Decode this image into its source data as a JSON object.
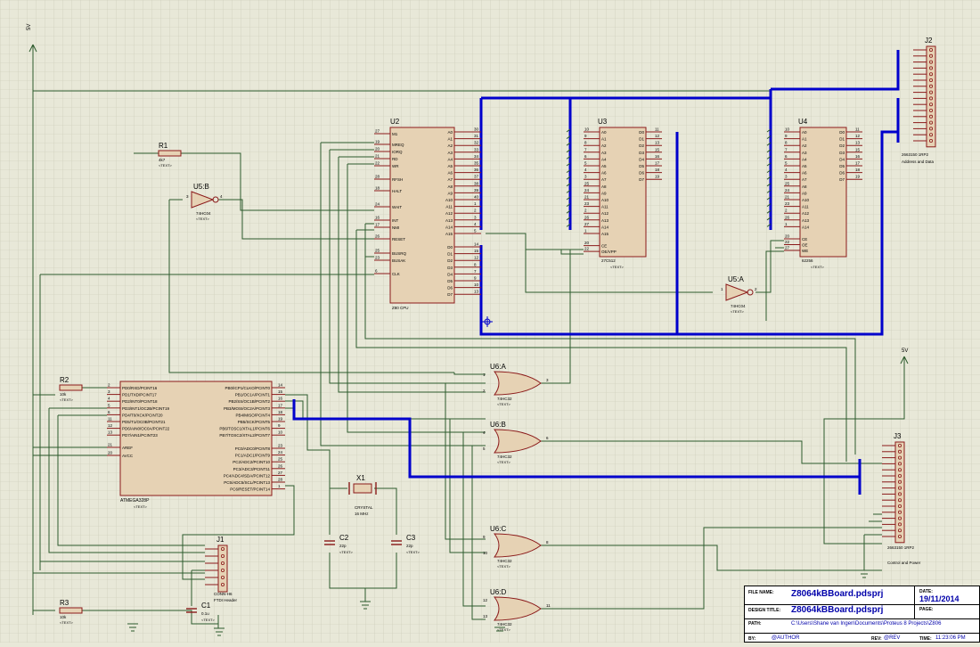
{
  "rail": {
    "left_top": "5V",
    "right": "5V"
  },
  "parts": {
    "R1": {
      "ref": "R1",
      "value": "4k7",
      "text": "<TEXT>"
    },
    "R2": {
      "ref": "R2",
      "value": "10k",
      "text": "<TEXT>"
    },
    "R3": {
      "ref": "R3",
      "value": "10k",
      "text": "<TEXT>"
    },
    "U5B": {
      "ref": "U5:B",
      "value": "74HC04",
      "text": "<TEXT>",
      "pin_in": "3",
      "pin_out": "4"
    },
    "U5A": {
      "ref": "U5:A",
      "value": "74HC04",
      "text": "<TEXT>",
      "pin_in": "1",
      "pin_out": "2"
    },
    "U2": {
      "ref": "U2",
      "value": "Z80 CPU",
      "left_pins": [
        {
          "num": "27",
          "name": "M1"
        },
        {
          "num": "19",
          "name": "MREQ"
        },
        {
          "num": "20",
          "name": "IORQ"
        },
        {
          "num": "21",
          "name": "RD"
        },
        {
          "num": "22",
          "name": "WR"
        },
        {
          "num": "28",
          "name": "RFSH"
        },
        {
          "num": "18",
          "name": "HALT"
        },
        {
          "num": "24",
          "name": "WAIT"
        },
        {
          "num": "16",
          "name": "INT"
        },
        {
          "num": "17",
          "name": "NMI"
        },
        {
          "num": "26",
          "name": "RESET"
        },
        {
          "num": "25",
          "name": "BUSRQ"
        },
        {
          "num": "23",
          "name": "BUSAK"
        },
        {
          "num": "6",
          "name": "CLK"
        }
      ],
      "addr_pins": [
        {
          "num": "30",
          "name": "A0"
        },
        {
          "num": "31",
          "name": "A1"
        },
        {
          "num": "32",
          "name": "A2"
        },
        {
          "num": "33",
          "name": "A3"
        },
        {
          "num": "34",
          "name": "A4"
        },
        {
          "num": "35",
          "name": "A5"
        },
        {
          "num": "36",
          "name": "A6"
        },
        {
          "num": "37",
          "name": "A7"
        },
        {
          "num": "38",
          "name": "A8"
        },
        {
          "num": "39",
          "name": "A9"
        },
        {
          "num": "40",
          "name": "A10"
        },
        {
          "num": "1",
          "name": "A11"
        },
        {
          "num": "2",
          "name": "A12"
        },
        {
          "num": "3",
          "name": "A13"
        },
        {
          "num": "4",
          "name": "A14"
        },
        {
          "num": "5",
          "name": "A15"
        }
      ],
      "data_pins": [
        {
          "num": "14",
          "name": "D0"
        },
        {
          "num": "15",
          "name": "D1"
        },
        {
          "num": "12",
          "name": "D2"
        },
        {
          "num": "8",
          "name": "D3"
        },
        {
          "num": "7",
          "name": "D4"
        },
        {
          "num": "9",
          "name": "D5"
        },
        {
          "num": "10",
          "name": "D6"
        },
        {
          "num": "13",
          "name": "D7"
        }
      ]
    },
    "U3": {
      "ref": "U3",
      "value": "27C512",
      "text": "<TEXT>",
      "addr_pins": [
        {
          "num": "10",
          "name": "A0"
        },
        {
          "num": "9",
          "name": "A1"
        },
        {
          "num": "8",
          "name": "A2"
        },
        {
          "num": "7",
          "name": "A3"
        },
        {
          "num": "6",
          "name": "A4"
        },
        {
          "num": "5",
          "name": "A5"
        },
        {
          "num": "4",
          "name": "A6"
        },
        {
          "num": "3",
          "name": "A7"
        },
        {
          "num": "25",
          "name": "A8"
        },
        {
          "num": "24",
          "name": "A9"
        },
        {
          "num": "21",
          "name": "A10"
        },
        {
          "num": "23",
          "name": "A11"
        },
        {
          "num": "2",
          "name": "A12"
        },
        {
          "num": "26",
          "name": "A13"
        },
        {
          "num": "27",
          "name": "A14"
        },
        {
          "num": "1",
          "name": "A15"
        }
      ],
      "ctrl_pins": [
        {
          "num": "20",
          "name": "CE"
        },
        {
          "num": "22",
          "name": "OE/VPP"
        }
      ],
      "data_pins": [
        {
          "num": "11",
          "name": "D0"
        },
        {
          "num": "12",
          "name": "D1"
        },
        {
          "num": "13",
          "name": "D2"
        },
        {
          "num": "15",
          "name": "D3"
        },
        {
          "num": "16",
          "name": "D4"
        },
        {
          "num": "17",
          "name": "D5"
        },
        {
          "num": "18",
          "name": "D6"
        },
        {
          "num": "19",
          "name": "D7"
        }
      ]
    },
    "U4": {
      "ref": "U4",
      "value": "62256",
      "text": "<TEXT>",
      "addr_pins": [
        {
          "num": "10",
          "name": "A0"
        },
        {
          "num": "9",
          "name": "A1"
        },
        {
          "num": "8",
          "name": "A2"
        },
        {
          "num": "7",
          "name": "A3"
        },
        {
          "num": "6",
          "name": "A4"
        },
        {
          "num": "5",
          "name": "A5"
        },
        {
          "num": "4",
          "name": "A6"
        },
        {
          "num": "3",
          "name": "A7"
        },
        {
          "num": "25",
          "name": "A8"
        },
        {
          "num": "24",
          "name": "A9"
        },
        {
          "num": "21",
          "name": "A10"
        },
        {
          "num": "23",
          "name": "A11"
        },
        {
          "num": "2",
          "name": "A12"
        },
        {
          "num": "26",
          "name": "A13"
        },
        {
          "num": "1",
          "name": "A14"
        }
      ],
      "ctrl_pins": [
        {
          "num": "20",
          "name": "CE"
        },
        {
          "num": "22",
          "name": "OE"
        },
        {
          "num": "27",
          "name": "WE"
        }
      ],
      "data_pins": [
        {
          "num": "11",
          "name": "D0"
        },
        {
          "num": "12",
          "name": "D1"
        },
        {
          "num": "13",
          "name": "D2"
        },
        {
          "num": "15",
          "name": "D3"
        },
        {
          "num": "16",
          "name": "D4"
        },
        {
          "num": "17",
          "name": "D5"
        },
        {
          "num": "18",
          "name": "D6"
        },
        {
          "num": "19",
          "name": "D7"
        }
      ]
    },
    "ATMEGA": {
      "ref": "ATMEGA328P",
      "text": "<TEXT>",
      "left_pins": [
        {
          "num": "2",
          "name": "PD0/RXD/PCINT16"
        },
        {
          "num": "3",
          "name": "PD1/TXD/PCINT17"
        },
        {
          "num": "4",
          "name": "PD2/INT0/PCINT18"
        },
        {
          "num": "5",
          "name": "PD3/INT1/OC2B/PCINT19"
        },
        {
          "num": "6",
          "name": "PD4/T0/XCK/PCINT20"
        },
        {
          "num": "11",
          "name": "PD5/T1/OC0B/PCINT21"
        },
        {
          "num": "12",
          "name": "PD6/AIN0/OC0A/PCINT22"
        },
        {
          "num": "13",
          "name": "PD7/AIN1/PCINT23"
        }
      ],
      "left_pins2": [
        {
          "num": "21",
          "name": "AREF"
        },
        {
          "num": "20",
          "name": "AVCC"
        }
      ],
      "right_pins": [
        {
          "num": "14",
          "name": "PB0/ICP1/CLKO/PCINT0"
        },
        {
          "num": "15",
          "name": "PB1/OC1A/PCINT1"
        },
        {
          "num": "16",
          "name": "PB2/SS/OC1B/PCINT2"
        },
        {
          "num": "17",
          "name": "PB3/MOSI/OC2A/PCINT3"
        },
        {
          "num": "18",
          "name": "PB4/MISO/PCINT4"
        },
        {
          "num": "19",
          "name": "PB5/SCK/PCINT5"
        },
        {
          "num": "9",
          "name": "PB6/TOSC1/XTAL1/PCINT6"
        },
        {
          "num": "10",
          "name": "PB7/TOSC2/XTAL2/PCINT7"
        }
      ],
      "right_pins2": [
        {
          "num": "23",
          "name": "PC0/ADC0/PCINT8"
        },
        {
          "num": "24",
          "name": "PC1/ADC1/PCINT9"
        },
        {
          "num": "25",
          "name": "PC2/ADC2/PCINT10"
        },
        {
          "num": "26",
          "name": "PC3/ADC3/PCINT11"
        },
        {
          "num": "27",
          "name": "PC4/ADC4/SDA/PCINT12"
        },
        {
          "num": "28",
          "name": "PC5/ADC5/SCL/PCINT13"
        },
        {
          "num": "1",
          "name": "PC6/RESET/PCINT14"
        }
      ]
    },
    "U6A": {
      "ref": "U6:A",
      "value": "74HC32",
      "text": "<TEXT>",
      "pins": [
        "1",
        "2",
        "3"
      ]
    },
    "U6B": {
      "ref": "U6:B",
      "value": "74HC32",
      "text": "<TEXT>",
      "pins": [
        "4",
        "5",
        "6"
      ]
    },
    "U6C": {
      "ref": "U6:C",
      "value": "74HC32",
      "text": "<TEXT>",
      "pins": [
        "9",
        "10",
        "8"
      ]
    },
    "U6D": {
      "ref": "U6:D",
      "value": "74HC32",
      "text": "<TEXT>",
      "pins": [
        "12",
        "13",
        "11"
      ]
    },
    "X1": {
      "ref": "X1",
      "value": "CRYSTAL",
      "freq": "16 MHz"
    },
    "C1": {
      "ref": "C1",
      "value": "0.1u",
      "text": "<TEXT>"
    },
    "C2": {
      "ref": "C2",
      "value": "22p",
      "text": "<TEXT>"
    },
    "C3": {
      "ref": "C3",
      "value": "22p",
      "text": "<TEXT>"
    },
    "J1": {
      "ref": "J1",
      "value": "CONN-H6",
      "desc": "FTDI Header",
      "pins": [
        "1",
        "2",
        "3",
        "4",
        "5",
        "6"
      ]
    },
    "J2": {
      "ref": "J2",
      "value": "2663150 1RP2",
      "desc": "Address and Data",
      "pins": [
        "1",
        "2",
        "3",
        "4",
        "5",
        "6",
        "7",
        "8",
        "9",
        "10",
        "11",
        "12",
        "13",
        "14",
        "15",
        "16"
      ]
    },
    "J3": {
      "ref": "J3",
      "value": "2663150 1RP2",
      "desc": "Control and Power",
      "pins": [
        "1",
        "2",
        "3",
        "4",
        "5",
        "6",
        "7",
        "8",
        "9",
        "10",
        "11",
        "12",
        "13",
        "14",
        "15",
        "16"
      ]
    }
  },
  "title_block": {
    "file_name_label": "FILE NAME:",
    "file_name": "Z8064kBBoard.pdsprj",
    "design_title_label": "DESIGN TITLE:",
    "design_title": "Z8064kBBoard.pdsprj",
    "path_label": "PATH:",
    "path": "C:\\Users\\Shane van Ingen\\Documents\\Proteus 8 Projects\\Z806",
    "by_label": "BY:",
    "by": "@AUTHOR",
    "date_label": "DATE:",
    "date": "19/11/2014",
    "page_label": "PAGE:",
    "rev_label": "REV:",
    "rev": "@REV",
    "time_label": "TIME:",
    "time": "11:23:06 PM"
  },
  "colors": {
    "background": "#e8e8d8",
    "grid": "#c8c8b4",
    "wire": "#2c5a2c",
    "bus": "#0000cc",
    "part_outline": "#8b1a1a",
    "part_fill": "#e6d2b4",
    "text": "#000000",
    "title_blue": "#0000aa"
  }
}
